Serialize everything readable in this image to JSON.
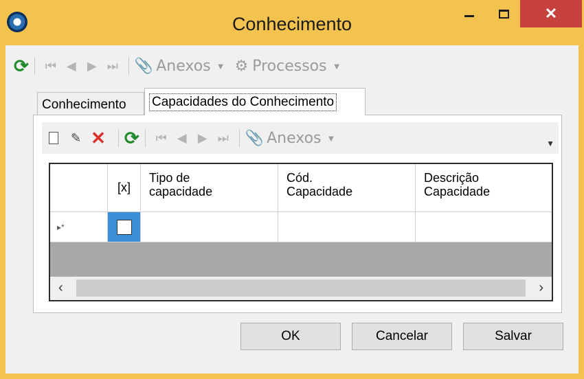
{
  "window": {
    "title": "Conhecimento",
    "close_glyph": "✕"
  },
  "toolbar": {
    "anexos_label": "Anexos",
    "processos_label": "Processos"
  },
  "tabs": [
    {
      "label": "Conhecimento"
    },
    {
      "label": "Capacidades do Conhecimento"
    }
  ],
  "inner_toolbar": {
    "anexos_label": "Anexos"
  },
  "grid": {
    "columns": [
      "[x]",
      "Tipo de\ncapacidade",
      "Cód.\nCapacidade",
      "Descrição\nCapacidade"
    ],
    "col_select": "[x]",
    "col_tipo_1": "Tipo de",
    "col_tipo_2": "capacidade",
    "col_cod_1": "Cód.",
    "col_cod_2": "Capacidade",
    "col_desc_1": "Descrição",
    "col_desc_2": "Capacidade",
    "new_row_indicator": "▸*"
  },
  "buttons": {
    "ok": "OK",
    "cancel": "Cancelar",
    "save": "Salvar"
  },
  "colors": {
    "title_bar": "#f4c24f",
    "close_button": "#c7413f",
    "refresh_icon": "#1f8a2a",
    "delete_icon": "#d9302b",
    "selected_cell": "#3b8fd9"
  }
}
